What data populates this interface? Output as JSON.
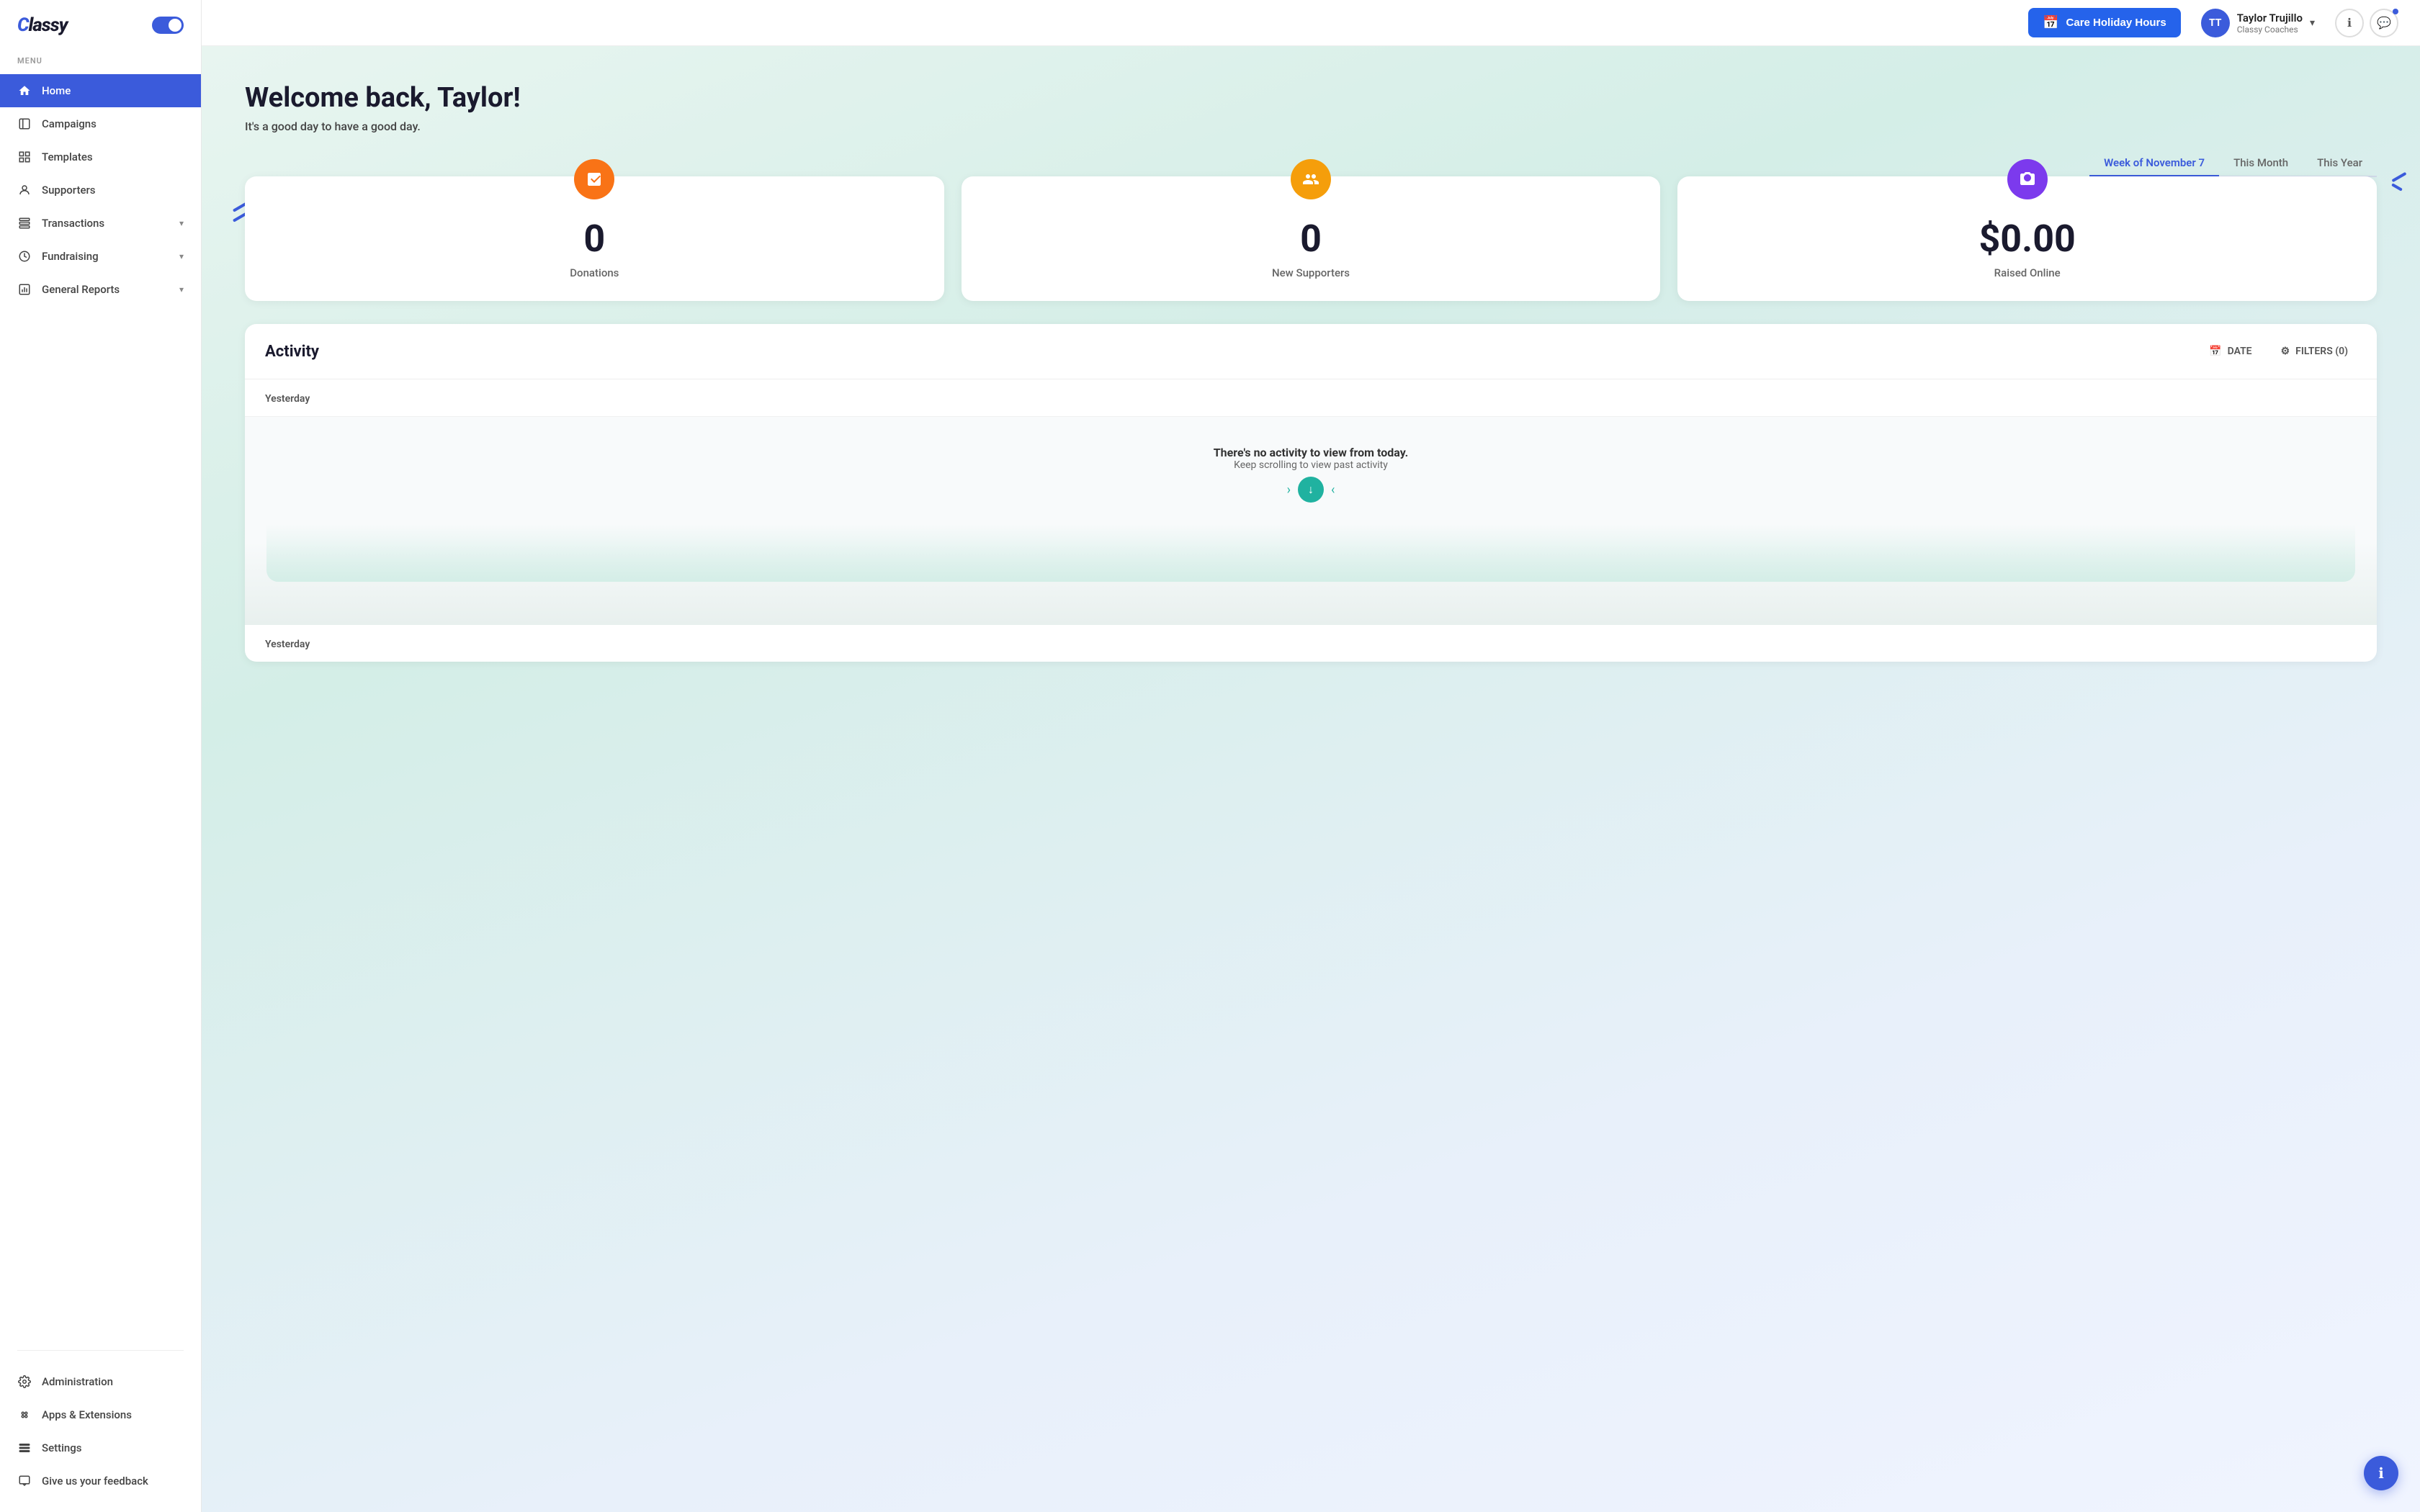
{
  "app": {
    "logo": "Classy",
    "toggle_label": "toggle"
  },
  "sidebar": {
    "menu_label": "MENU",
    "items": [
      {
        "id": "home",
        "label": "Home",
        "active": true,
        "icon": "home-icon",
        "has_chevron": false
      },
      {
        "id": "campaigns",
        "label": "Campaigns",
        "active": false,
        "icon": "campaigns-icon",
        "has_chevron": false
      },
      {
        "id": "templates",
        "label": "Templates",
        "active": false,
        "icon": "templates-icon",
        "has_chevron": false
      },
      {
        "id": "supporters",
        "label": "Supporters",
        "active": false,
        "icon": "supporters-icon",
        "has_chevron": false
      },
      {
        "id": "transactions",
        "label": "Transactions",
        "active": false,
        "icon": "transactions-icon",
        "has_chevron": true
      },
      {
        "id": "fundraising",
        "label": "Fundraising",
        "active": false,
        "icon": "fundraising-icon",
        "has_chevron": true
      },
      {
        "id": "general-reports",
        "label": "General Reports",
        "active": false,
        "icon": "reports-icon",
        "has_chevron": true
      }
    ],
    "bottom_items": [
      {
        "id": "administration",
        "label": "Administration",
        "icon": "admin-icon"
      },
      {
        "id": "apps-extensions",
        "label": "Apps & Extensions",
        "icon": "apps-icon"
      },
      {
        "id": "settings",
        "label": "Settings",
        "icon": "settings-icon"
      },
      {
        "id": "feedback",
        "label": "Give us your feedback",
        "icon": "feedback-icon"
      }
    ]
  },
  "header": {
    "care_button_label": "Care Holiday Hours",
    "user_initials": "TT",
    "user_name": "Taylor Trujillo",
    "user_org": "Classy Coaches",
    "chevron": "▾"
  },
  "main": {
    "welcome_title": "Welcome back, Taylor!",
    "welcome_sub": "It's a good day to have a good day.",
    "period_tabs": [
      {
        "label": "Week of November 7",
        "active": true
      },
      {
        "label": "This Month",
        "active": false
      },
      {
        "label": "This Year",
        "active": false
      }
    ],
    "stats": [
      {
        "value": "0",
        "label": "Donations",
        "icon_color": "orange",
        "icon": "📋"
      },
      {
        "value": "0",
        "label": "New Supporters",
        "icon_color": "amber",
        "icon": "👥"
      },
      {
        "value": "$0.00",
        "label": "Raised Online",
        "icon_color": "purple",
        "icon": "📷"
      }
    ],
    "activity": {
      "title": "Activity",
      "date_btn": "DATE",
      "filters_btn": "FILTERS (0)",
      "date_label": "Yesterday",
      "empty_title": "There's no activity to view from today.",
      "empty_sub": "Keep scrolling to view past activity",
      "bottom_date_label": "Yesterday"
    }
  }
}
